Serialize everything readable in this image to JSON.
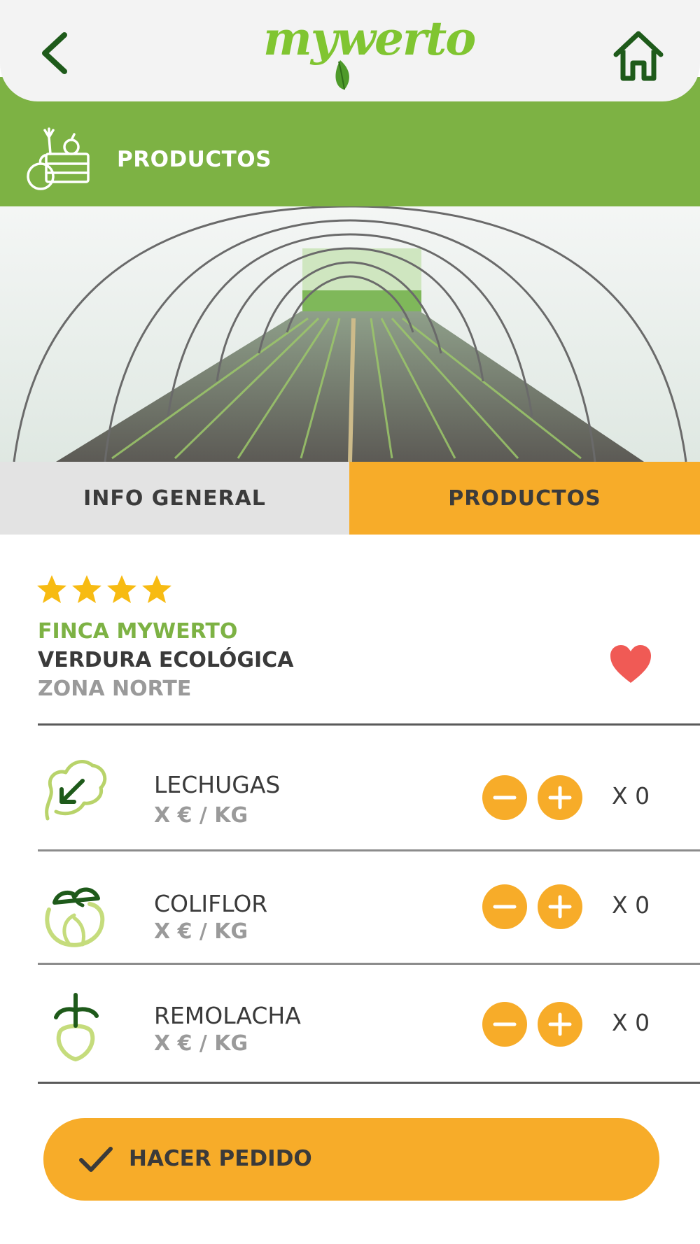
{
  "app": {
    "logo_text": "mywerto"
  },
  "section": {
    "title": "PRODUCTOS"
  },
  "tabs": [
    {
      "label": "INFO GENERAL",
      "active": false
    },
    {
      "label": "PRODUCTOS",
      "active": true
    }
  ],
  "farm": {
    "rating": 4,
    "name": "FINCA MYWERTO",
    "type": "VERDURA ECOLÓGICA",
    "zone": "ZONA NORTE",
    "favorite": true
  },
  "products": [
    {
      "name": "LECHUGAS",
      "price": "X € / KG",
      "quantity": "X 0",
      "icon": "lettuce-icon"
    },
    {
      "name": "COLIFLOR",
      "price": "X € / KG",
      "quantity": "X 0",
      "icon": "cauliflower-icon"
    },
    {
      "name": "REMOLACHA",
      "price": "X € / KG",
      "quantity": "X 0",
      "icon": "beet-icon"
    }
  ],
  "order": {
    "label": "HACER PEDIDO"
  },
  "colors": {
    "brand_green": "#7db244",
    "accent_orange": "#f7ac29",
    "dark_green": "#1e5a1a",
    "heart_red": "#f05a55",
    "star_yellow": "#f7bb12"
  }
}
